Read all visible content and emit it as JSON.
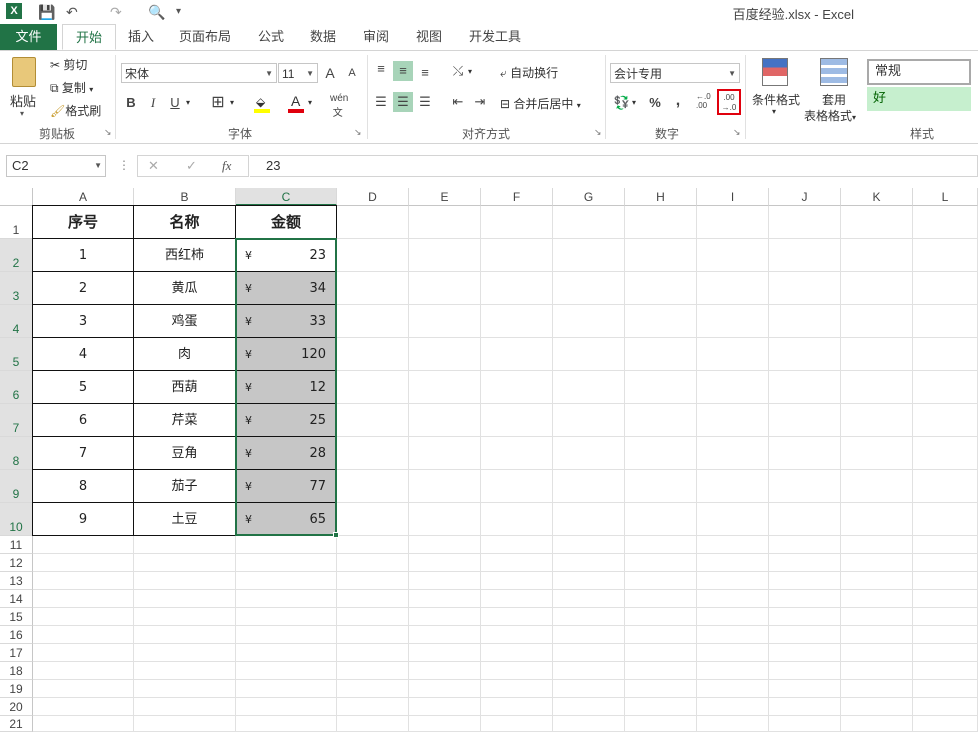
{
  "titlebar": {
    "app_badge": "X",
    "title": "百度经验.xlsx - Excel",
    "quick_access": {
      "save": "💾",
      "undo": "↶",
      "redo": "↷",
      "preview": "🔍",
      "more": "▾"
    }
  },
  "tabs": [
    {
      "label": "文件"
    },
    {
      "label": "开始"
    },
    {
      "label": "插入"
    },
    {
      "label": "页面布局"
    },
    {
      "label": "公式"
    },
    {
      "label": "数据"
    },
    {
      "label": "审阅"
    },
    {
      "label": "视图"
    },
    {
      "label": "开发工具"
    }
  ],
  "ribbon": {
    "clipboard": {
      "paste": "粘贴",
      "cut": "剪切",
      "copy": "复制",
      "format_painter": "格式刷",
      "label": "剪贴板"
    },
    "font": {
      "name": "宋体",
      "size": "11",
      "grow": "A",
      "shrink": "A",
      "bold": "B",
      "italic": "I",
      "underline": "U",
      "wen": "wén",
      "label": "字体"
    },
    "alignment": {
      "wrap": "自动换行",
      "merge": "合并后居中",
      "label": "对齐方式"
    },
    "number": {
      "format": "会计专用",
      "percent": "%",
      "comma": ",",
      "inc_decimal": "←.0 .00",
      "dec_decimal": ".00 →.0",
      "label": "数字"
    },
    "styles": {
      "conditional": "条件格式",
      "table_format_1": "套用",
      "table_format_2": "表格格式",
      "normal": "常规",
      "good": "好",
      "label": "样式"
    }
  },
  "formula_bar": {
    "name_box": "C2",
    "cancel": "✕",
    "enter": "✓",
    "fx": "fx",
    "value": "23"
  },
  "columns": [
    "A",
    "B",
    "C",
    "D",
    "E",
    "F",
    "G",
    "H",
    "I",
    "J",
    "K",
    "L"
  ],
  "rows": [
    "1",
    "2",
    "3",
    "4",
    "5",
    "6",
    "7",
    "8",
    "9",
    "10",
    "11",
    "12",
    "13",
    "14",
    "15",
    "16",
    "17",
    "18",
    "19",
    "20",
    "21"
  ],
  "table": {
    "headers": [
      "序号",
      "名称",
      "金额"
    ],
    "currency": "¥",
    "records": [
      {
        "no": "1",
        "name": "西红柿",
        "amount": "23"
      },
      {
        "no": "2",
        "name": "黄瓜",
        "amount": "34"
      },
      {
        "no": "3",
        "name": "鸡蛋",
        "amount": "33"
      },
      {
        "no": "4",
        "name": "肉",
        "amount": "120"
      },
      {
        "no": "5",
        "name": "西葫",
        "amount": "12"
      },
      {
        "no": "6",
        "name": "芹菜",
        "amount": "25"
      },
      {
        "no": "7",
        "name": "豆角",
        "amount": "28"
      },
      {
        "no": "8",
        "name": "茄子",
        "amount": "77"
      },
      {
        "no": "9",
        "name": "土豆",
        "amount": "65"
      }
    ]
  },
  "colors": {
    "brand": "#217346",
    "selection_fill": "#c6c6c6",
    "highlight_box": "#e0000d"
  }
}
